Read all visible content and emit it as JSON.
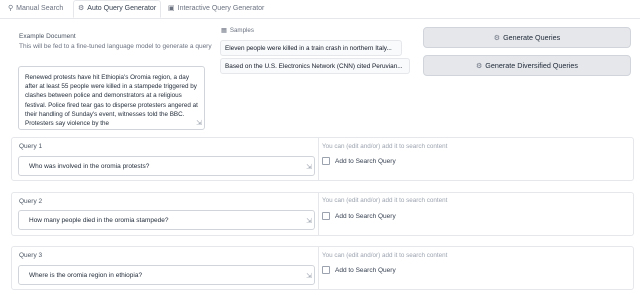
{
  "tabs": [
    {
      "label": "Manual Search",
      "icon": "search-icon"
    },
    {
      "label": "Auto Query Generator",
      "icon": "gear-icon"
    },
    {
      "label": "Interactive Query Generator",
      "icon": "window-icon"
    }
  ],
  "example": {
    "label": "Example Document",
    "description": "This will be fed to a fine-tuned language model to generate a query",
    "text": "Renewed protests have hit Ethiopia's Oromia region, a day after at least 55 people were killed in a stampede triggered by clashes between police and demonstrators at a religious festival.  Police fired tear gas to disperse protesters angered at their handling of Sunday's event, witnesses told the BBC.  Protesters say violence by the"
  },
  "samples": {
    "label": "Samples",
    "items": [
      "Eleven people were killed in a train crash in northern Italy...",
      "Based on the U.S. Electronics Network (CNN) cited Peruvian..."
    ]
  },
  "buttons": {
    "generate": "Generate Queries",
    "generate_diversified": "Generate Diversified Queries"
  },
  "queries": [
    {
      "label": "Query 1",
      "value": "Who was involved in the oromia protests?",
      "hint": "You can (edit and/or) add it to search content",
      "checkbox": "Add to Search Query"
    },
    {
      "label": "Query 2",
      "value": "How many people died in the oromia stampede?",
      "hint": "You can (edit and/or) add it to search content",
      "checkbox": "Add to Search Query"
    },
    {
      "label": "Query 3",
      "value": "Where is the oromia region in ethiopia?",
      "hint": "You can (edit and/or) add it to search content",
      "checkbox": "Add to Search Query"
    }
  ]
}
